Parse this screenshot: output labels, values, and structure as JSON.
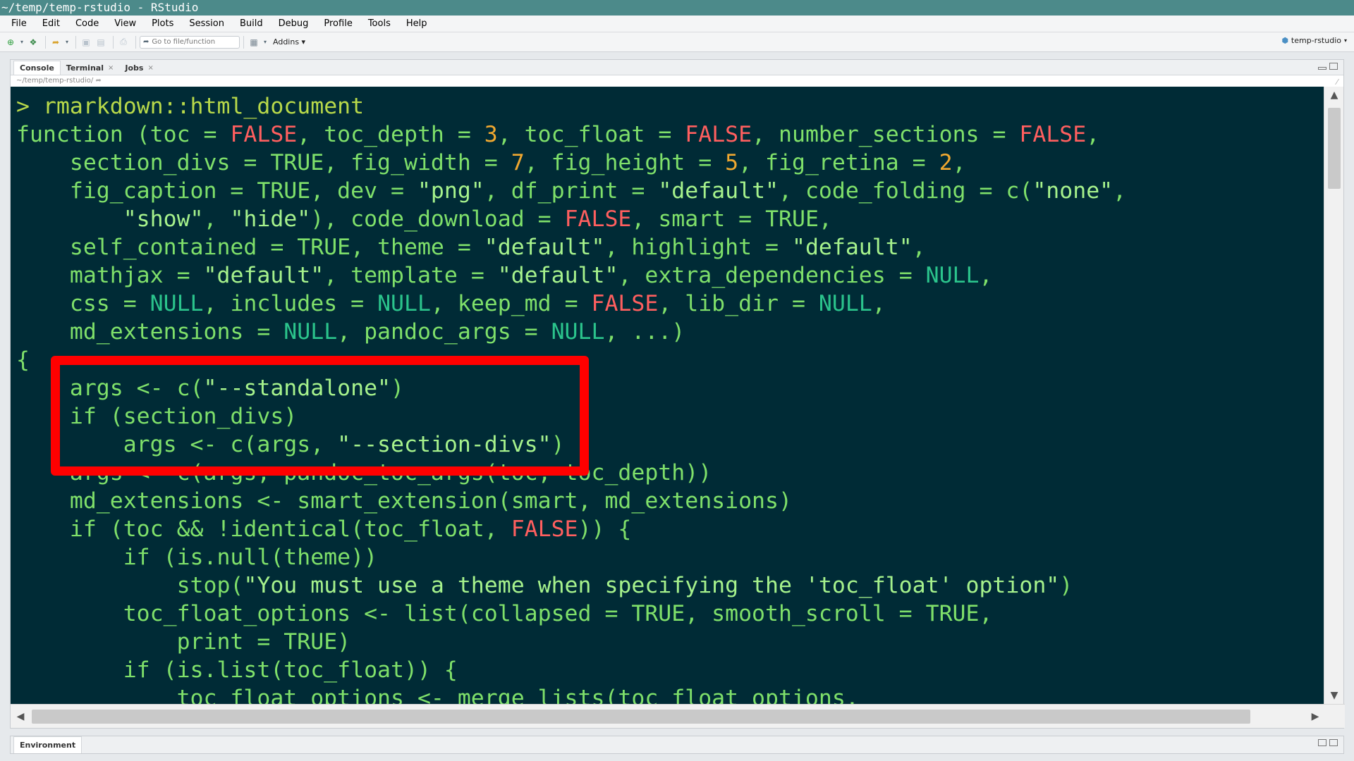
{
  "window": {
    "title": "~/temp/temp-rstudio - RStudio"
  },
  "menu": [
    "File",
    "Edit",
    "Code",
    "View",
    "Plots",
    "Session",
    "Build",
    "Debug",
    "Profile",
    "Tools",
    "Help"
  ],
  "toolbar": {
    "goto_placeholder": "Go to file/function",
    "addins_label": "Addins",
    "project_label": "temp-rstudio"
  },
  "console_pane": {
    "tabs": [
      {
        "label": "Console",
        "closable": false,
        "active": true
      },
      {
        "label": "Terminal",
        "closable": true,
        "active": false
      },
      {
        "label": "Jobs",
        "closable": true,
        "active": false
      }
    ],
    "working_dir": "~/temp/temp-rstudio/",
    "lines": [
      [
        [
          "> ",
          "prompt"
        ],
        [
          "rmarkdown::html_document",
          "prompt"
        ]
      ],
      [
        [
          "function (toc = ",
          "c"
        ],
        [
          "FALSE",
          "kw"
        ],
        [
          ", toc_depth = ",
          "c"
        ],
        [
          "3",
          "num"
        ],
        [
          ", toc_float = ",
          "c"
        ],
        [
          "FALSE",
          "kw"
        ],
        [
          ", number_sections = ",
          "c"
        ],
        [
          "FALSE",
          "kw"
        ],
        [
          ",",
          "c"
        ]
      ],
      [
        [
          "    section_divs = ",
          "c"
        ],
        [
          "TRUE",
          "c"
        ],
        [
          ", fig_width = ",
          "c"
        ],
        [
          "7",
          "num"
        ],
        [
          ", fig_height = ",
          "c"
        ],
        [
          "5",
          "num"
        ],
        [
          ", fig_retina = ",
          "c"
        ],
        [
          "2",
          "num"
        ],
        [
          ",",
          "c"
        ]
      ],
      [
        [
          "    fig_caption = ",
          "c"
        ],
        [
          "TRUE",
          "c"
        ],
        [
          ", dev = ",
          "c"
        ],
        [
          "\"png\"",
          "str"
        ],
        [
          ", df_print = ",
          "c"
        ],
        [
          "\"default\"",
          "str"
        ],
        [
          ", code_folding = c(",
          "c"
        ],
        [
          "\"none\"",
          "str"
        ],
        [
          ",",
          "c"
        ]
      ],
      [
        [
          "        ",
          "c"
        ],
        [
          "\"show\"",
          "str"
        ],
        [
          ", ",
          "c"
        ],
        [
          "\"hide\"",
          "str"
        ],
        [
          "), code_download = ",
          "c"
        ],
        [
          "FALSE",
          "kw"
        ],
        [
          ", smart = ",
          "c"
        ],
        [
          "TRUE",
          "c"
        ],
        [
          ",",
          "c"
        ]
      ],
      [
        [
          "    self_contained = ",
          "c"
        ],
        [
          "TRUE",
          "c"
        ],
        [
          ", theme = ",
          "c"
        ],
        [
          "\"default\"",
          "str"
        ],
        [
          ", highlight = ",
          "c"
        ],
        [
          "\"default\"",
          "str"
        ],
        [
          ",",
          "c"
        ]
      ],
      [
        [
          "    mathjax = ",
          "c"
        ],
        [
          "\"default\"",
          "str"
        ],
        [
          ", template = ",
          "c"
        ],
        [
          "\"default\"",
          "str"
        ],
        [
          ", extra_dependencies = ",
          "c"
        ],
        [
          "NULL",
          "nul"
        ],
        [
          ",",
          "c"
        ]
      ],
      [
        [
          "    css = ",
          "c"
        ],
        [
          "NULL",
          "nul"
        ],
        [
          ", includes = ",
          "c"
        ],
        [
          "NULL",
          "nul"
        ],
        [
          ", keep_md = ",
          "c"
        ],
        [
          "FALSE",
          "kw"
        ],
        [
          ", lib_dir = ",
          "c"
        ],
        [
          "NULL",
          "nul"
        ],
        [
          ",",
          "c"
        ]
      ],
      [
        [
          "    md_extensions = ",
          "c"
        ],
        [
          "NULL",
          "nul"
        ],
        [
          ", pandoc_args = ",
          "c"
        ],
        [
          "NULL",
          "nul"
        ],
        [
          ", ...)",
          "c"
        ]
      ],
      [
        [
          "{",
          "c"
        ]
      ],
      [
        [
          "    args <- c(",
          "c"
        ],
        [
          "\"--standalone\"",
          "str"
        ],
        [
          ")",
          "c"
        ]
      ],
      [
        [
          "    if (section_divs)",
          "c"
        ]
      ],
      [
        [
          "        args <- c(args, ",
          "c"
        ],
        [
          "\"--section-divs\"",
          "str"
        ],
        [
          ")",
          "c"
        ]
      ],
      [
        [
          "    args <- c(args, pandoc_toc_args(toc, toc_depth))",
          "c"
        ]
      ],
      [
        [
          "    md_extensions <- smart_extension(smart, md_extensions)",
          "c"
        ]
      ],
      [
        [
          "    if (toc && !identical(toc_float, ",
          "c"
        ],
        [
          "FALSE",
          "kw"
        ],
        [
          ")) {",
          "c"
        ]
      ],
      [
        [
          "        if (is.null(theme))",
          "c"
        ]
      ],
      [
        [
          "            stop(",
          "c"
        ],
        [
          "\"You must use a theme when specifying the 'toc_float' option\"",
          "str"
        ],
        [
          ")",
          "c"
        ]
      ],
      [
        [
          "        toc_float_options <- list(collapsed = ",
          "c"
        ],
        [
          "TRUE",
          "c"
        ],
        [
          ", smooth_scroll = ",
          "c"
        ],
        [
          "TRUE",
          "c"
        ],
        [
          ",",
          "c"
        ]
      ],
      [
        [
          "            print = ",
          "c"
        ],
        [
          "TRUE",
          "c"
        ],
        [
          ")",
          "c"
        ]
      ],
      [
        [
          "        if (is.list(toc_float)) {",
          "c"
        ]
      ],
      [
        [
          "            toc_float_options <- merge_lists(toc_float_options,",
          "c"
        ]
      ]
    ]
  },
  "bottom_pane": {
    "tab_label": "Environment"
  },
  "colors": {
    "console_bg": "#002b36",
    "code_text": "#7fe06a",
    "keyword_false": "#ff5f5f",
    "number": "#f0a830",
    "highlight_box": "#ff0000"
  }
}
